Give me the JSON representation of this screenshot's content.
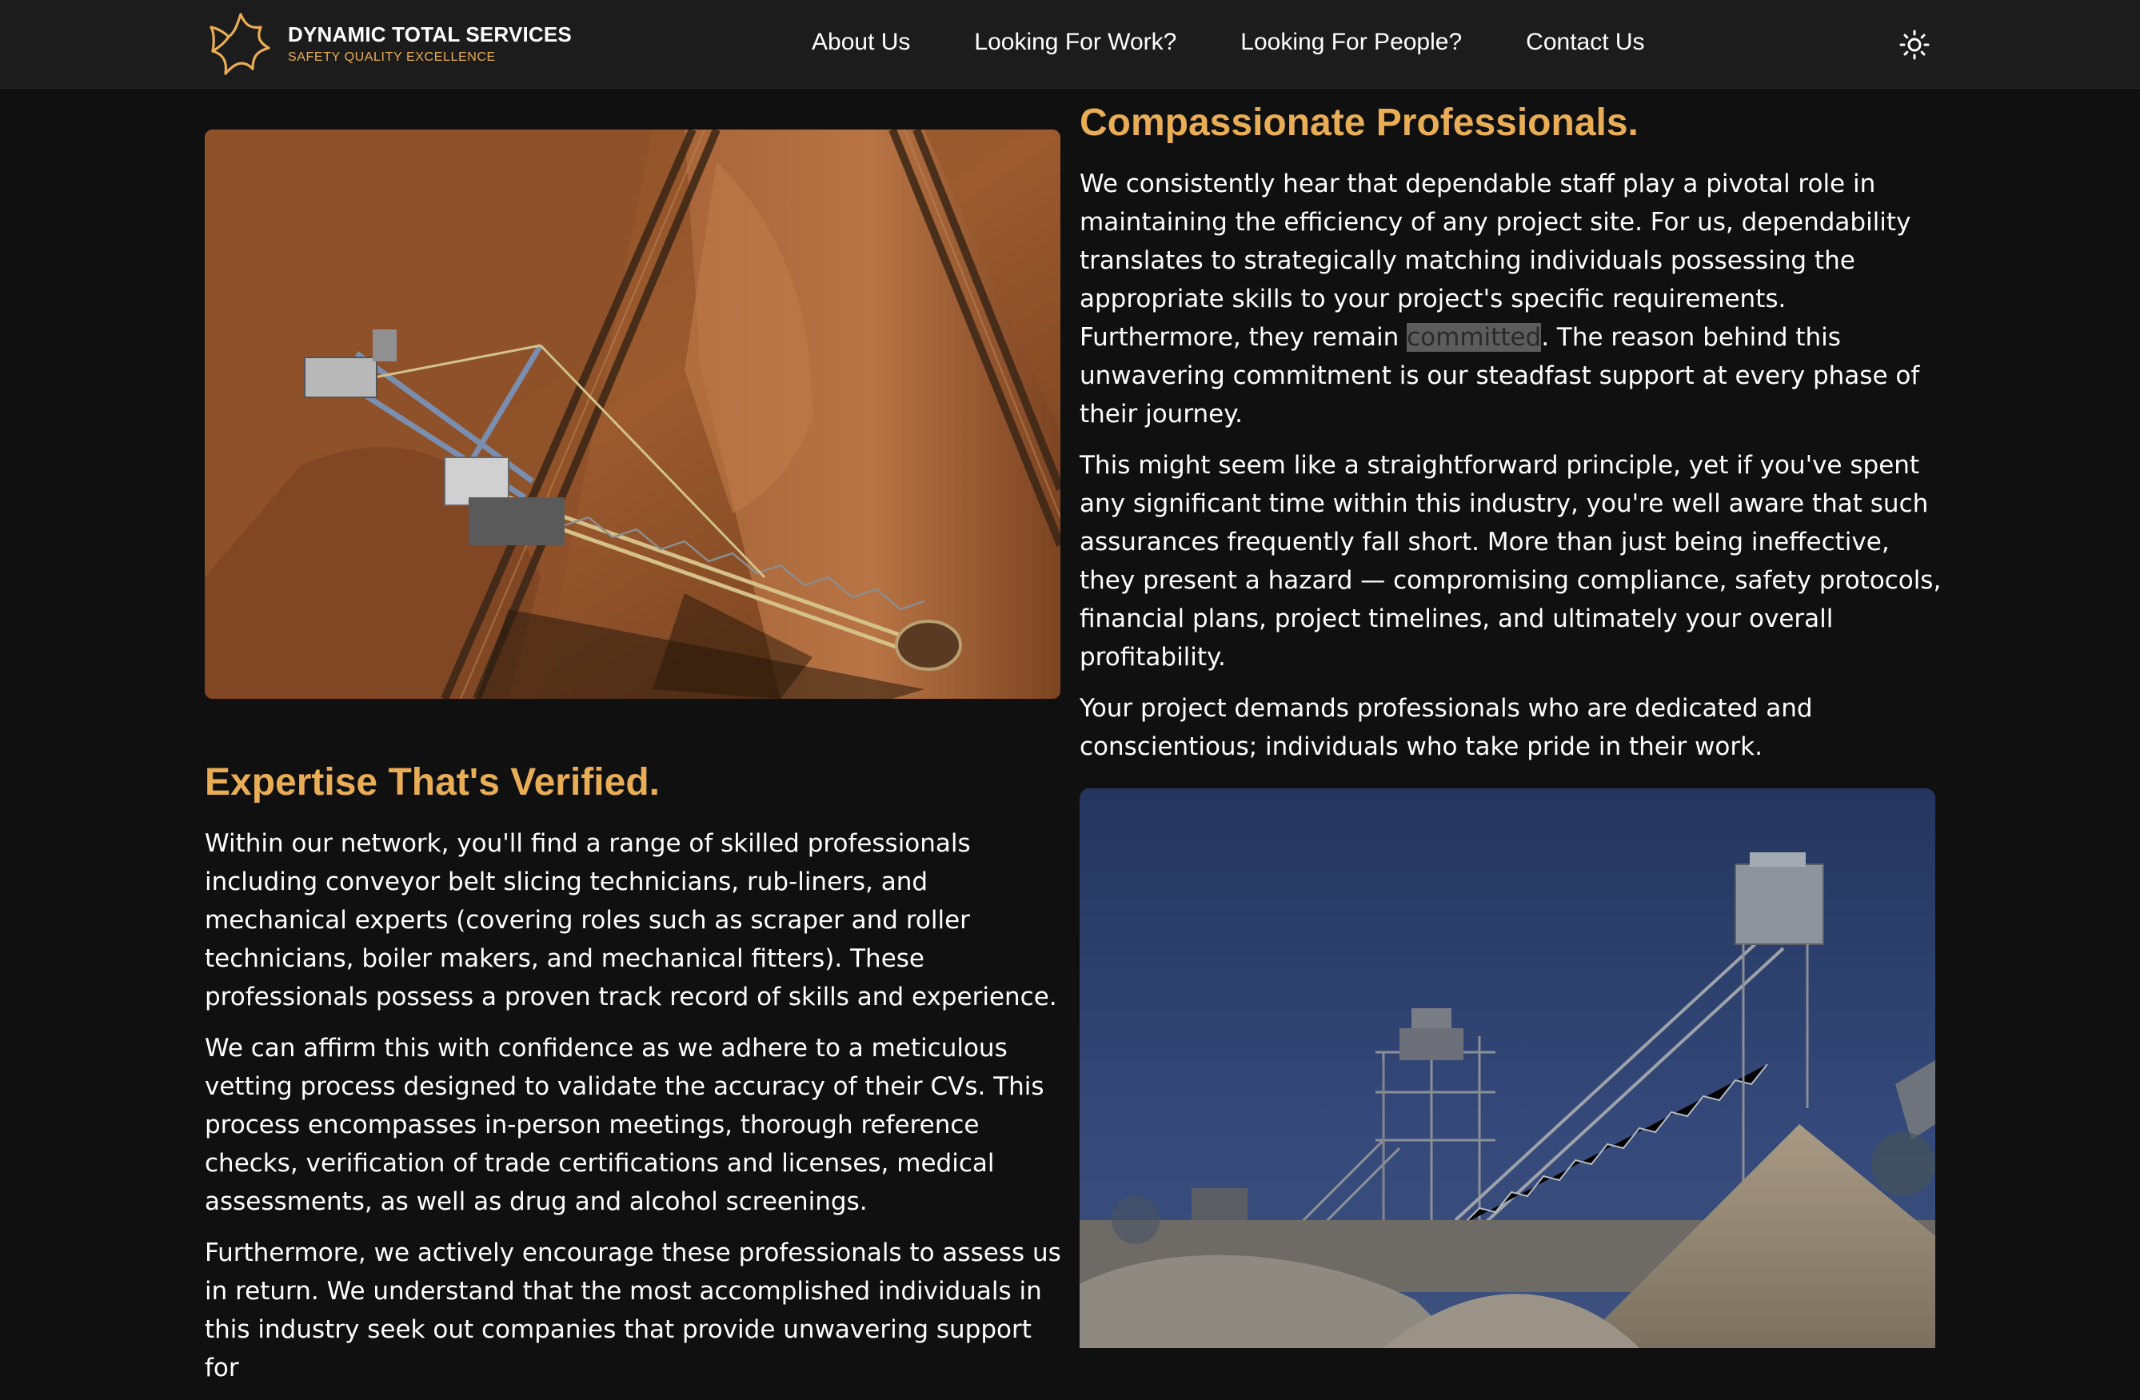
{
  "header": {
    "brand_name": "DYNAMIC TOTAL SERVICES",
    "brand_tagline": "SAFETY QUALITY EXCELLENCE",
    "nav": [
      {
        "label": "About Us"
      },
      {
        "label": "Looking For Work?"
      },
      {
        "label": "Looking For People?"
      },
      {
        "label": "Contact Us"
      }
    ],
    "theme_icon": "sun-icon",
    "colors": {
      "accent": "#e8ad55",
      "header_bg": "#1c1c1c",
      "page_bg": "#101010"
    }
  },
  "section1": {
    "title": "Compassionate Professionals.",
    "p1_before": "We consistently hear that dependable staff play a pivotal role in maintaining the efficiency of any project site. For us, dependability translates to strategically matching individuals possessing the appropriate skills to your project's specific requirements. Furthermore, they remain ",
    "p1_highlight": "committed",
    "p1_after": ". The reason behind this unwavering commitment is our steadfast support at every phase of their journey.",
    "p2": "This might seem like a straightforward principle, yet if you've spent any significant time within this industry, you're well aware that such assurances frequently fall short. More than just being ineffective, they present a hazard — compromising compliance, safety protocols, financial plans, project timelines, and ultimately your overall profitability.",
    "p3": "Your project demands professionals who are dedicated and conscientious; individuals who take pride in their work."
  },
  "section2": {
    "title": "Expertise That's Verified.",
    "p1": "Within our network, you'll find a range of skilled professionals including conveyor belt slicing technicians, rub-liners, and mechanical experts (covering roles such as scraper and roller technicians, boiler makers, and mechanical fitters). These professionals possess a proven track record of skills and experience.",
    "p2": "We can affirm this with confidence as we adhere to a meticulous vetting process designed to validate the accuracy of their CVs. This process encompasses in-person meetings, thorough reference checks, verification of trade certifications and licenses, medical assessments, as well as drug and alcohol screenings.",
    "p3": "Furthermore, we actively encourage these professionals to assess us in return. We understand that the most accomplished individuals in this industry seek out companies that provide unwavering support for"
  }
}
